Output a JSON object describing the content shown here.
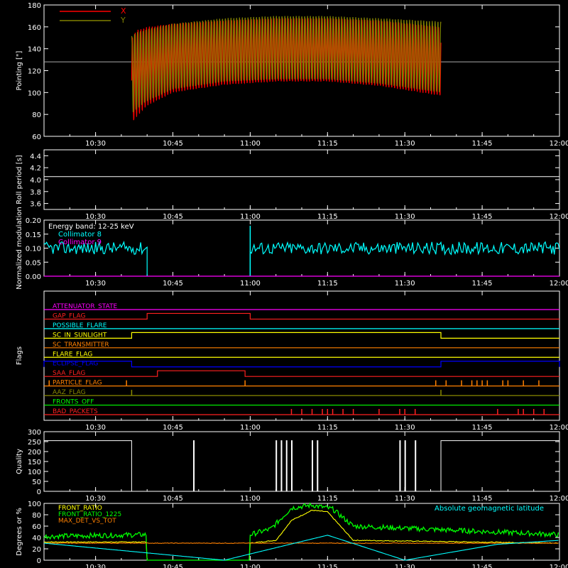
{
  "time_ticks": [
    "10:30",
    "10:45",
    "11:00",
    "11:15",
    "11:30",
    "11:45",
    "12:00"
  ],
  "colors": {
    "X": "#ff0000",
    "Y": "#808000",
    "cyan": "#00ffff",
    "magenta": "#ff00ff",
    "green": "#00ff00",
    "yellow": "#ffff00",
    "orange": "#ff8000",
    "blue": "#0000ff",
    "red_flag": "#ff2020",
    "aaz": "#8a8a00",
    "white": "#ffffff"
  },
  "chart_data": [
    {
      "id": "pointing",
      "type": "line",
      "ylabel": "Pointing [\"]",
      "ylim": [
        60,
        180
      ],
      "yticks": [
        60,
        80,
        100,
        120,
        140,
        160,
        180
      ],
      "legend": [
        "X",
        "Y"
      ],
      "legend_placement": "top-left",
      "reference_line": 128,
      "series": [
        {
          "name": "X",
          "envelope_time": [
            "10:37",
            "10:38",
            "10:40",
            "10:45",
            "10:55",
            "11:05",
            "11:15",
            "11:25",
            "11:37"
          ],
          "upper": [
            150,
            157,
            160,
            163,
            166,
            168,
            168,
            166,
            160
          ],
          "lower": [
            72,
            78,
            88,
            100,
            107,
            110,
            110,
            106,
            97
          ]
        },
        {
          "name": "Y",
          "envelope_time": [
            "10:37",
            "10:38",
            "10:40",
            "10:45",
            "10:55",
            "11:05",
            "11:15",
            "11:25",
            "11:37"
          ],
          "upper": [
            152,
            155,
            158,
            163,
            168,
            170,
            170,
            168,
            165
          ],
          "lower": [
            80,
            85,
            92,
            103,
            110,
            112,
            112,
            108,
            100
          ]
        }
      ]
    },
    {
      "id": "roll",
      "type": "line",
      "ylabel": "Roll period [s]",
      "ylim": [
        3.5,
        4.5
      ],
      "yticks": [
        "3.6",
        "3.8",
        "4.0",
        "4.2",
        "4.4"
      ],
      "series": [
        {
          "value": 4.05
        }
      ]
    },
    {
      "id": "modulation",
      "type": "line",
      "ylabel": "Normalized modulation",
      "ylim": [
        0.0,
        0.2
      ],
      "yticks": [
        "0.00",
        "0.05",
        "0.10",
        "0.15",
        "0.20"
      ],
      "legend_title": "Energy band: 12-25 keV",
      "legend": [
        "Collimator 8",
        "Collimator 9"
      ],
      "series": [
        {
          "name": "Collimator 8",
          "segments": [
            [
              "10:20",
              "10:40",
              0.1
            ],
            [
              "11:00",
              "12:00",
              0.1
            ]
          ],
          "spike": [
            "11:00",
            0.18
          ]
        },
        {
          "name": "Collimator 9",
          "value": 0.0
        }
      ]
    },
    {
      "id": "flags",
      "type": "line",
      "ylabel": "Flags",
      "rows": [
        {
          "name": "ATTENUATOR_STATE",
          "color": "magenta",
          "high": []
        },
        {
          "name": "GAP_FLAG",
          "color": "red_flag",
          "high": [
            [
              "10:40",
              "11:00"
            ]
          ]
        },
        {
          "name": "POSSIBLE_FLARE",
          "color": "cyan",
          "high": []
        },
        {
          "name": "SC_IN_SUNLIGHT",
          "color": "yellow",
          "high": [
            [
              "10:37",
              "11:37"
            ]
          ]
        },
        {
          "name": "SC_TRANSMITTER",
          "color": "orange",
          "high": []
        },
        {
          "name": "FLARE_FLAG",
          "color": "yellow",
          "high": []
        },
        {
          "name": "ECLIPSE_FLAG",
          "color": "blue",
          "high": [
            [
              "10:20",
              "10:37"
            ],
            [
              "11:37",
              "12:00"
            ]
          ]
        },
        {
          "name": "SAA_FLAG",
          "color": "red_flag",
          "high": [
            [
              "10:42",
              "10:59"
            ]
          ]
        },
        {
          "name": "PARTICLE_FLAG",
          "color": "orange",
          "spikes": [
            "10:21",
            "10:36",
            "10:59",
            "11:36",
            "11:38",
            "11:41",
            "11:43",
            "11:44",
            "11:45",
            "11:46",
            "11:49",
            "11:50",
            "11:53",
            "11:56"
          ]
        },
        {
          "name": "AAZ_FLAG",
          "color": "aaz",
          "spikes": [
            "10:37",
            "11:37"
          ]
        },
        {
          "name": "FRONTS_OFF",
          "color": "green",
          "high": []
        },
        {
          "name": "BAD_PACKETS",
          "color": "red_flag",
          "spikes": [
            "11:08",
            "11:10",
            "11:12",
            "11:14",
            "11:15",
            "11:16",
            "11:18",
            "11:20",
            "11:25",
            "11:29",
            "11:30",
            "11:32",
            "11:48",
            "11:52",
            "11:53",
            "11:55",
            "11:57"
          ]
        }
      ]
    },
    {
      "id": "quality",
      "type": "line",
      "ylabel": "Quality",
      "ylim": [
        0,
        300
      ],
      "yticks": [
        "0",
        "50",
        "100",
        "150",
        "200",
        "250",
        "300"
      ],
      "series": [
        {
          "high": 255,
          "low": 0,
          "low_intervals": [
            [
              "10:37",
              "11:37"
            ]
          ],
          "spikes": [
            "10:49",
            "11:05",
            "11:06",
            "11:07",
            "11:08",
            "11:12",
            "11:13",
            "11:29",
            "11:30",
            "11:32"
          ]
        }
      ]
    },
    {
      "id": "ratios",
      "type": "line",
      "ylabel": "Degrees or %",
      "ylim": [
        0,
        100
      ],
      "yticks": [
        "0",
        "20",
        "40",
        "60",
        "80",
        "100"
      ],
      "legend": [
        "FRONT_RATIO",
        "FRONT_RATIO_1225",
        "MAX_DET_VS_TOT"
      ],
      "annotation": "Absolute geomagnetic latitude",
      "series": [
        {
          "name": "FRONT_RATIO",
          "color": "yellow",
          "x": [
            "10:20",
            "10:40",
            "10:40",
            "11:00",
            "11:00",
            "11:05",
            "11:08",
            "11:12",
            "11:15",
            "11:20",
            "12:00"
          ],
          "y": [
            32,
            32,
            0,
            0,
            30,
            35,
            70,
            88,
            85,
            35,
            30
          ]
        },
        {
          "name": "FRONT_RATIO_1225",
          "color": "green",
          "x": [
            "10:20",
            "10:40",
            "10:40",
            "11:00",
            "11:00",
            "11:04",
            "11:08",
            "11:12",
            "11:16",
            "11:20",
            "12:00"
          ],
          "y": [
            42,
            45,
            0,
            0,
            45,
            55,
            92,
            97,
            90,
            60,
            45
          ]
        },
        {
          "name": "MAX_DET_VS_TOT",
          "color": "orange",
          "x": [
            "10:20",
            "12:00"
          ],
          "y": [
            30,
            30
          ]
        },
        {
          "name": "Absolute geomagnetic latitude",
          "color": "cyan",
          "x": [
            "10:20",
            "10:55",
            "11:15",
            "11:30",
            "11:48",
            "12:00"
          ],
          "y": [
            30,
            0,
            44,
            0,
            28,
            35
          ]
        }
      ]
    }
  ]
}
